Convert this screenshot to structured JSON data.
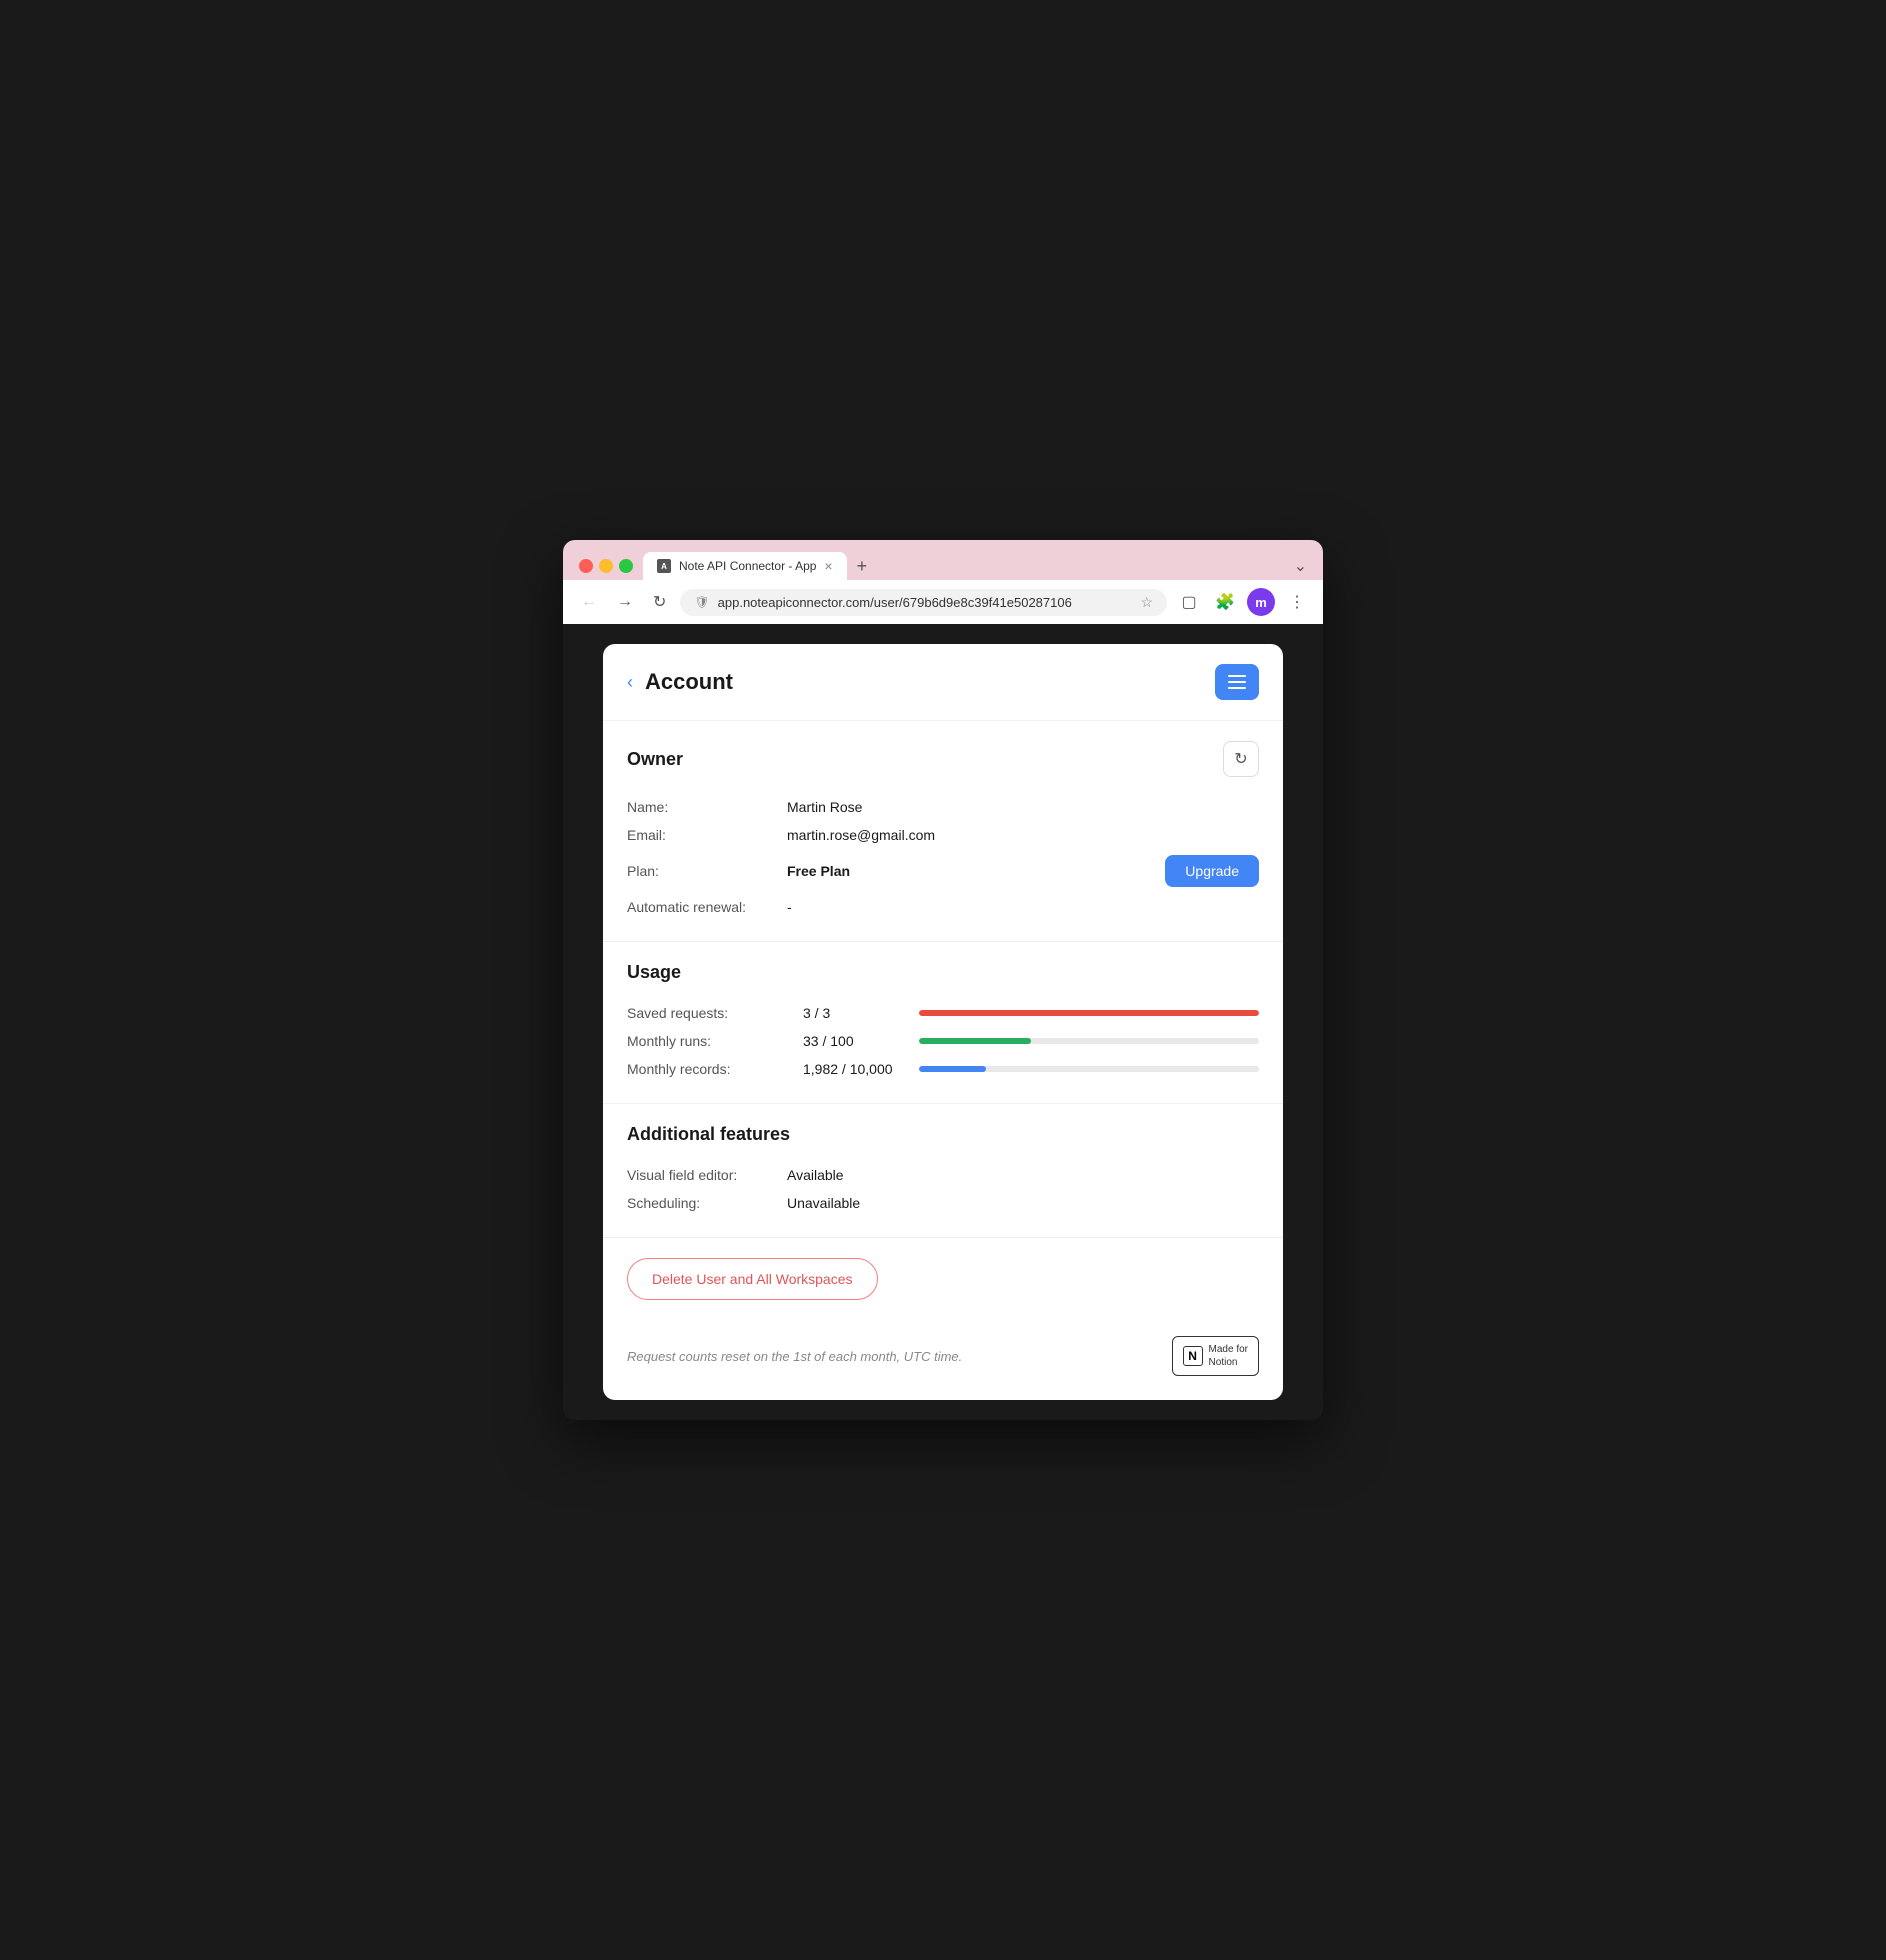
{
  "browser": {
    "tab_title": "Note API Connector - App",
    "tab_close": "×",
    "tab_new": "+",
    "tab_expand": "⌄",
    "url": "app.noteapiconnector.com/user/679b6d9e8c39f41e50287106",
    "avatar_initials": "m"
  },
  "header": {
    "back_icon": "‹",
    "title": "Account",
    "menu_icon": "menu"
  },
  "owner_section": {
    "title": "Owner",
    "fields": [
      {
        "label": "Name:",
        "value": "Martin Rose"
      },
      {
        "label": "Email:",
        "value": "martin.rose@gmail.com"
      },
      {
        "label": "Plan:",
        "value": "Free Plan"
      },
      {
        "label": "Automatic renewal:",
        "value": "-"
      }
    ],
    "upgrade_label": "Upgrade"
  },
  "usage_section": {
    "title": "Usage",
    "items": [
      {
        "label": "Saved requests:",
        "value": "3 / 3",
        "percent": 100,
        "color": "#e74c3c"
      },
      {
        "label": "Monthly runs:",
        "value": "33 / 100",
        "percent": 33,
        "color": "#27ae60"
      },
      {
        "label": "Monthly records:",
        "value": "1,982 / 10,000",
        "percent": 19.82,
        "color": "#4285f4"
      }
    ]
  },
  "additional_section": {
    "title": "Additional features",
    "fields": [
      {
        "label": "Visual field editor:",
        "value": "Available"
      },
      {
        "label": "Scheduling:",
        "value": "Unavailable"
      }
    ]
  },
  "delete_button_label": "Delete User and All Workspaces",
  "footer": {
    "note": "Request counts reset on the 1st of each month, UTC time.",
    "badge_line1": "Made for",
    "badge_line2": "Notion",
    "badge_n": "N"
  }
}
